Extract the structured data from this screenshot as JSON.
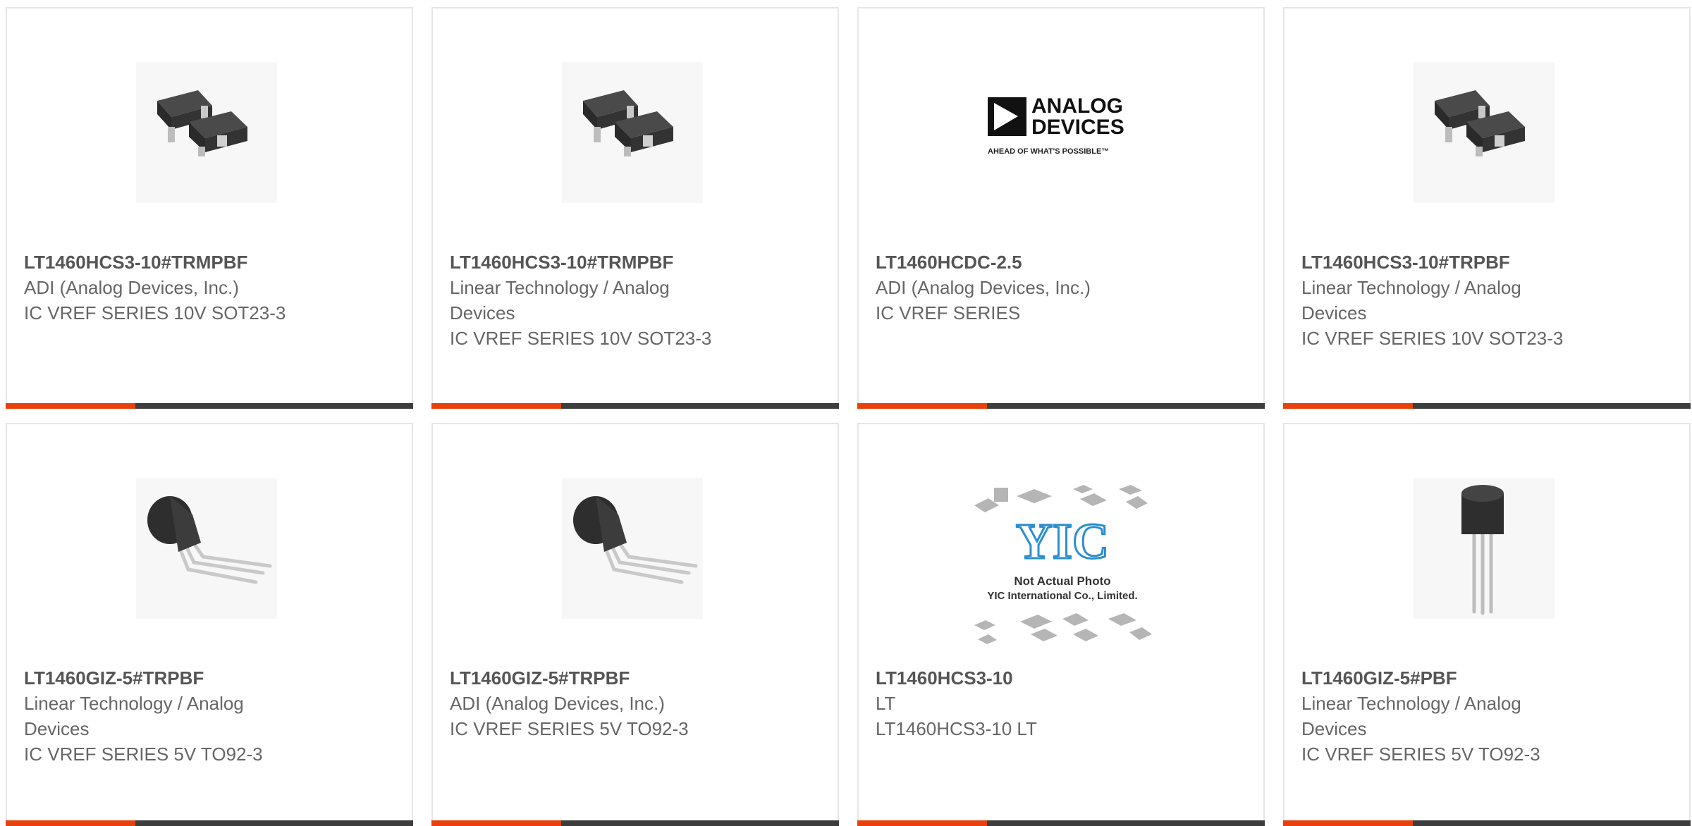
{
  "colors": {
    "accent": "#e8410e",
    "bar": "#3d3d3d",
    "title": "#555555",
    "text": "#666666"
  },
  "products": [
    {
      "part": "LT1460HCS3-10#TRMPBF",
      "manufacturer": "ADI (Analog Devices, Inc.)",
      "description": "IC VREF SERIES 10V SOT23-3",
      "image": "sot23-package-icon"
    },
    {
      "part": "LT1460HCS3-10#TRMPBF",
      "manufacturer": "Linear Technology / Analog Devices",
      "description": "IC VREF SERIES 10V SOT23-3",
      "image": "sot23-package-icon"
    },
    {
      "part": "LT1460HCDC-2.5",
      "manufacturer": "ADI (Analog Devices, Inc.)",
      "description": "IC VREF SERIES",
      "image": "analog-devices-logo",
      "logo": {
        "line1": "ANALOG",
        "line2": "DEVICES",
        "tagline": "AHEAD OF WHAT'S POSSIBLE™"
      }
    },
    {
      "part": "LT1460HCS3-10#TRPBF",
      "manufacturer": "Linear Technology / Analog Devices",
      "description": "IC VREF SERIES 10V SOT23-3",
      "image": "sot23-package-icon"
    },
    {
      "part": "LT1460GIZ-5#TRPBF",
      "manufacturer": "Linear Technology / Analog Devices",
      "description": "IC VREF SERIES 5V TO92-3",
      "image": "to92-package-icon"
    },
    {
      "part": "LT1460GIZ-5#TRPBF",
      "manufacturer": "ADI (Analog Devices, Inc.)",
      "description": "IC VREF SERIES 5V TO92-3",
      "image": "to92-package-icon"
    },
    {
      "part": "LT1460HCS3-10",
      "manufacturer": "LT",
      "description": "LT1460HCS3-10 LT",
      "image": "not-actual-photo-placeholder",
      "placeholder": {
        "brand": "YIC",
        "line1": "Not Actual Photo",
        "line2": "YIC International Co., Limited."
      }
    },
    {
      "part": "LT1460GIZ-5#PBF",
      "manufacturer": "Linear Technology / Analog Devices",
      "description": "IC VREF SERIES 5V TO92-3",
      "image": "to92-vertical-package-icon"
    }
  ]
}
